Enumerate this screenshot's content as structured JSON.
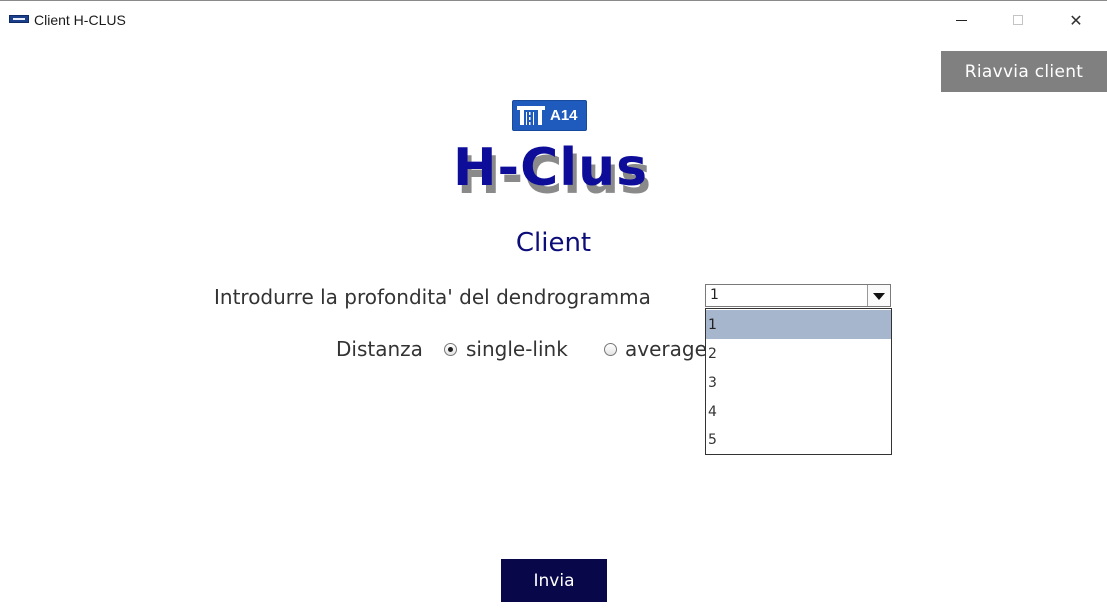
{
  "window": {
    "title": "Client H-CLUS",
    "minimize_glyph": "",
    "close_glyph": "✕"
  },
  "header": {
    "restart_label": "Riavvia client",
    "logo_text": "A14",
    "brand": "H-Clus",
    "subtitle": "Client"
  },
  "form": {
    "depth_label": "Introdurre la profondita' del dendrogramma",
    "depth_selected": "1",
    "depth_options": [
      "1",
      "2",
      "3",
      "4",
      "5"
    ],
    "distance_label": "Distanza",
    "distance_options": [
      {
        "label": "single-link",
        "checked": true
      },
      {
        "label": "average",
        "checked": false
      }
    ],
    "submit_label": "Invia"
  },
  "colors": {
    "brand": "#0d0d9a",
    "brand_shadow": "#8a8a8a",
    "submit_bg": "#07074a",
    "restart_bg": "#808080",
    "selection": "#a6b6cd",
    "logo_bg": "#1f5bbd"
  },
  "icons": {
    "app": "app-flag-icon",
    "logo": "motorway-icon",
    "combo_arrow": "triangle-down-icon"
  }
}
